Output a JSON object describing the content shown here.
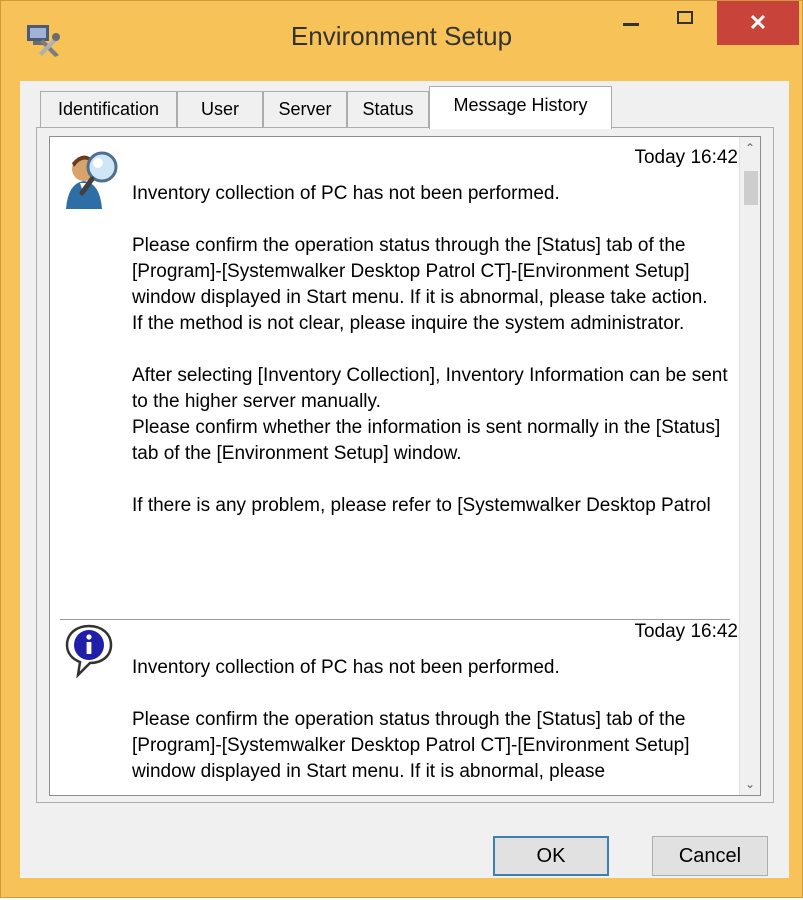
{
  "window": {
    "title": "Environment Setup"
  },
  "tabs": [
    {
      "label": "Identification"
    },
    {
      "label": "User"
    },
    {
      "label": "Server"
    },
    {
      "label": "Status"
    },
    {
      "label": "Message History",
      "active": true
    }
  ],
  "messages": [
    {
      "time": "Today 16:42",
      "icon": "user-search-icon",
      "paragraphs": [
        "Inventory collection of PC has not been performed.",
        "Please confirm the operation status through the [Status] tab of the [Program]-[Systemwalker Desktop Patrol CT]-[Environment Setup] window displayed in Start menu. If it is abnormal, please take action.\nIf the method is not clear, please inquire the system administrator.",
        "After selecting [Inventory Collection], Inventory Information can be sent to the higher server manually.\nPlease confirm whether the information is sent normally in the [Status] tab of the [Environment Setup] window.",
        "If there is any problem, please refer to [Systemwalker Desktop Patrol"
      ]
    },
    {
      "time": "Today 16:42",
      "icon": "info-icon",
      "paragraphs": [
        "Inventory collection of PC has not been performed.",
        "Please confirm the operation status through the [Status] tab of the [Program]-[Systemwalker Desktop Patrol CT]-[Environment Setup] window displayed in Start menu. If it is abnormal, please"
      ]
    }
  ],
  "buttons": {
    "ok": "OK",
    "cancel": "Cancel"
  },
  "colors": {
    "titlebar": "#f7c257",
    "close": "#c84339",
    "ok_border": "#3c7fb1"
  }
}
